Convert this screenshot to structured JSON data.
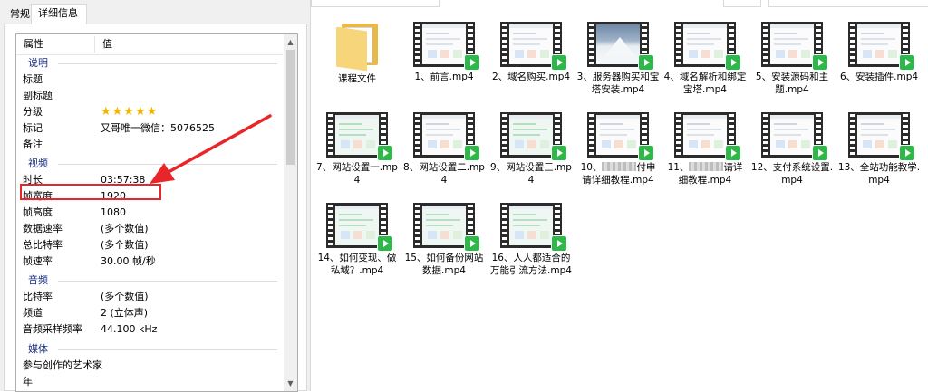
{
  "dialog": {
    "tabs": [
      {
        "label": "常规"
      },
      {
        "label": "详细信息"
      }
    ],
    "columns": {
      "name": "属性",
      "value": "值"
    },
    "groups": {
      "description": "说明",
      "video": "视频",
      "audio": "音频",
      "media": "媒体"
    },
    "rows": {
      "title": {
        "name": "标题",
        "value": ""
      },
      "subtitle": {
        "name": "副标题",
        "value": ""
      },
      "rating": {
        "name": "分级",
        "value": "★★★★★",
        "stars": 5
      },
      "tags": {
        "name": "标记",
        "value": "又哥唯一微信：5076525"
      },
      "comments": {
        "name": "备注",
        "value": ""
      },
      "duration": {
        "name": "时长",
        "value": "03:57:38"
      },
      "frame_width": {
        "name": "帧宽度",
        "value": "1920"
      },
      "frame_height": {
        "name": "帧高度",
        "value": "1080"
      },
      "data_rate": {
        "name": "数据速率",
        "value": "(多个数值)"
      },
      "total_bitrate": {
        "name": "总比特率",
        "value": "(多个数值)"
      },
      "frame_rate": {
        "name": "帧速率",
        "value": "30.00 帧/秒"
      },
      "audio_bitrate": {
        "name": "比特率",
        "value": "(多个数值)"
      },
      "channels": {
        "name": "频道",
        "value": "2 (立体声)"
      },
      "sample_rate": {
        "name": "音频采样频率",
        "value": "44.100 kHz"
      },
      "contributing_artists": {
        "name": "参与创作的艺术家",
        "value": ""
      },
      "year": {
        "name": "年",
        "value": ""
      }
    },
    "scroll": {
      "up": "▲",
      "down": "▼"
    }
  },
  "explorer": {
    "items": [
      {
        "name": "课程文件",
        "kind": "folder"
      },
      {
        "name": "1、前言.mp4",
        "kind": "video"
      },
      {
        "name": "2、域名购买.mp4",
        "kind": "video"
      },
      {
        "name": "3、服务器购买和宝塔安装.mp4",
        "kind": "video",
        "thumb": "mountain"
      },
      {
        "name": "4、域名解析和绑定宝塔.mp4",
        "kind": "video"
      },
      {
        "name": "5、安装源码和主题.mp4",
        "kind": "video"
      },
      {
        "name": "6、安装插件.mp4",
        "kind": "video"
      },
      {
        "name": "7、网站设置一.mp4",
        "kind": "video",
        "thumb": "green"
      },
      {
        "name": "8、网站设置二.mp4",
        "kind": "video"
      },
      {
        "name": "9、网站设置三.mp4",
        "kind": "video",
        "thumb": "green"
      },
      {
        "name_pre": "10、",
        "name_post": "付申请详细教程.mp4",
        "kind": "video",
        "redacted": true
      },
      {
        "name_pre": "11、",
        "name_post": "请详细教程.mp4",
        "kind": "video",
        "redacted": true
      },
      {
        "name": "12、支付系统设置.mp4",
        "kind": "video"
      },
      {
        "name": "13、全站功能教学.mp4",
        "kind": "video"
      },
      {
        "name": "14、如何变现、做私域？.mp4",
        "kind": "video",
        "thumb": "green"
      },
      {
        "name": "15、如何备份网站数据.mp4",
        "kind": "video",
        "thumb": "green"
      },
      {
        "name": "16、人人都适合的万能引流方法.mp4",
        "kind": "video",
        "thumb": "green"
      }
    ]
  },
  "colors": {
    "highlight": "#e8262a",
    "group_title": "#1e3287",
    "play_badge": "#2fb84a",
    "stars": "#f2b400"
  }
}
